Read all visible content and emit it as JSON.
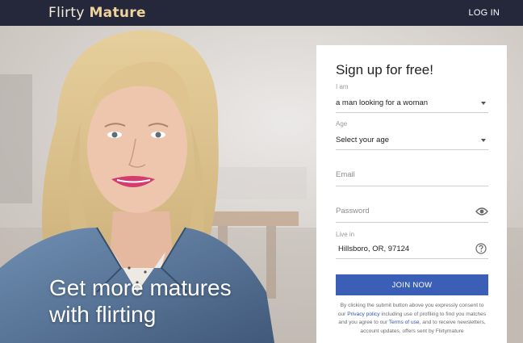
{
  "header": {
    "logo_part1": "Flirty",
    "logo_part2": "Mature",
    "login_label": "LOG IN"
  },
  "hero": {
    "tagline_line1": "Get more matures",
    "tagline_line2": "with flirting"
  },
  "signup": {
    "title": "Sign up for free!",
    "iam_label": "I am",
    "iam_value": "a man looking for a woman",
    "age_label": "Age",
    "age_value": "Select your age",
    "email_placeholder": "Email",
    "password_placeholder": "Password",
    "live_label": "Live in",
    "live_value": "Hillsboro, OR, 97124",
    "join_label": "JOIN NOW",
    "consent_1": "By clicking the submit button above you expressly consent to our",
    "privacy_link": "Privacy policy",
    "consent_2": "including use of profiling to find you matches and you agree to our",
    "terms_link": "Terms of use",
    "consent_3": ", and to receive newsletters, account updates, offers sent by Flirtymature"
  },
  "colors": {
    "topbar": "#25283b",
    "join_button": "#3b5eb6",
    "link": "#2d56b3"
  },
  "icons": {
    "dropdown": "chevron-down-icon",
    "password_toggle": "eye-icon",
    "help": "question-circle-icon"
  }
}
